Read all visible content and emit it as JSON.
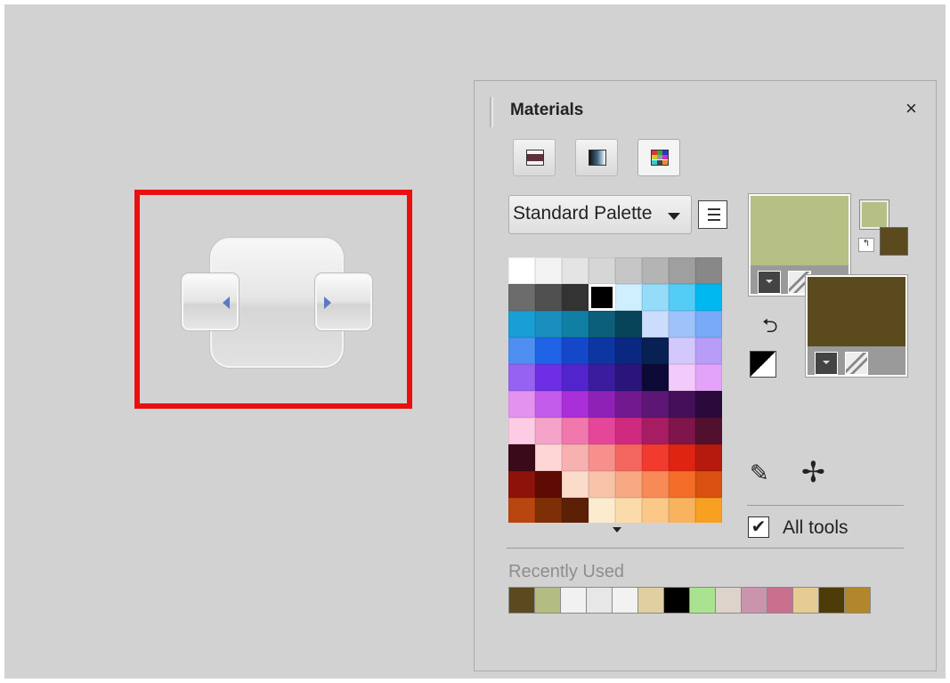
{
  "panel": {
    "title": "Materials",
    "close_glyph": "×",
    "tabs": [
      {
        "name": "frame-tab",
        "icon": "frame-icon",
        "active": false
      },
      {
        "name": "gradient-tab",
        "icon": "gradient-icon",
        "active": false
      },
      {
        "name": "swatches-tab",
        "icon": "swatch-grid-icon",
        "active": true
      }
    ],
    "palette_select": {
      "value": "Standard Palette"
    },
    "swatches": [
      "#ffffff",
      "#f3f3f3",
      "#e4e4e4",
      "#d6d6d6",
      "#c6c6c6",
      "#b4b4b4",
      "#9f9f9f",
      "#888888",
      "#6c6c6c",
      "#505050",
      "#333333",
      "#000000",
      "#cfefff",
      "#95dcf9",
      "#53cdf6",
      "#00b8f0",
      "#1a9ed6",
      "#198ebf",
      "#117ea3",
      "#0b5f7a",
      "#074459",
      "#cbdcfc",
      "#9ec2fa",
      "#79aaf7",
      "#4f8ff2",
      "#1f63e6",
      "#1548c9",
      "#0d36a2",
      "#0a2781",
      "#082054",
      "#d3c8fb",
      "#b79df7",
      "#9662f2",
      "#6d2ee6",
      "#5224cc",
      "#3b1c9e",
      "#2a157b",
      "#0d0937",
      "#f3cbfa",
      "#e3a3f8",
      "#e492f0",
      "#c35cea",
      "#ab2fd8",
      "#8f22b6",
      "#73198f",
      "#5e1676",
      "#451059",
      "#2a0a3a",
      "#fdcbe3",
      "#f6a3c9",
      "#f078ad",
      "#e6469a",
      "#cf2a7f",
      "#a71d64",
      "#7f154b",
      "#52102f",
      "#3a0a1a",
      "#ffd6d6",
      "#f8b1b1",
      "#f7908c",
      "#f4675e",
      "#f13b2f",
      "#df2412",
      "#b51a0d",
      "#8d130a",
      "#5f0b04",
      "#fbdbc9",
      "#f8c3a9",
      "#f8a882",
      "#f78a57",
      "#f36d26",
      "#d95011",
      "#b9460e",
      "#7f2f08",
      "#5b2006",
      "#fdebd0",
      "#fcdbab",
      "#fbc887",
      "#f9b25e",
      "#f7a022"
    ],
    "selected_swatch_index": 11,
    "foreground": {
      "color": "#b6bf84",
      "label": "foreground-color"
    },
    "background": {
      "color": "#5c4a1f",
      "label": "background-color"
    },
    "swap_small_glyph": "↰",
    "swap_large_glyph": "⮌",
    "dropper_glyph": "✎",
    "pointer_glyph": "✢",
    "all_tools": {
      "checked": true,
      "check_glyph": "✔",
      "label": "All tools"
    },
    "recently_used": {
      "label": "Recently Used",
      "colors": [
        "#5b4a1f",
        "#b3bd82",
        "#f1f1f1",
        "#e7e7e7",
        "#f2f2f2",
        "#e0cfa0",
        "#000000",
        "#a9e38f",
        "#ddd3ca",
        "#c994ac",
        "#c9708f",
        "#e4cc92",
        "#4d3b08",
        "#b2862b"
      ]
    }
  },
  "dock_widget": {
    "left_arrow": "dock-left-arrow-icon",
    "right_arrow": "dock-right-arrow-icon",
    "highlight_color": "#ea1010"
  }
}
